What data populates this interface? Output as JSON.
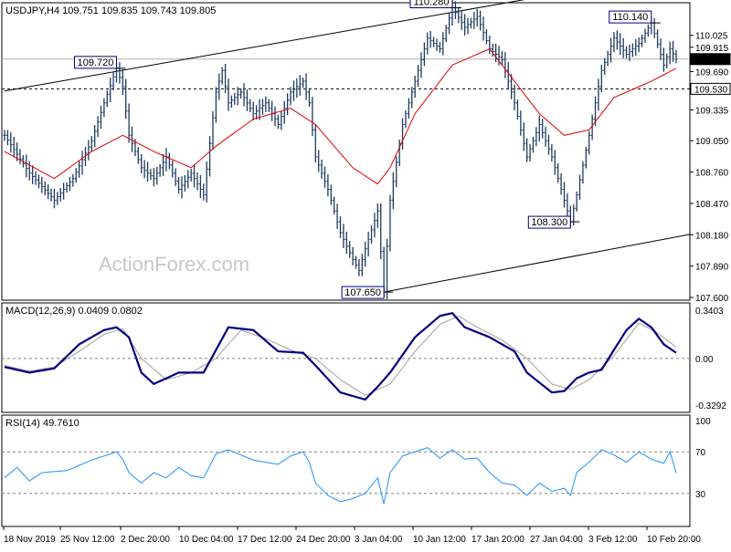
{
  "chart_data": [
    {
      "type": "candlestick",
      "header": "USDJPY,H4  109.751 109.835 109.743 109.805",
      "watermark": "ActionForex.com",
      "ylim": [
        107.6,
        110.2
      ],
      "y_ticks": [
        "110.025",
        "109.915",
        "109.805",
        "109.690",
        "109.530",
        "109.335",
        "109.050",
        "108.760",
        "108.470",
        "108.180",
        "107.890",
        "107.600"
      ],
      "price_line": 109.805,
      "dashed_level": 109.53,
      "moving_average_color": "#e00000",
      "bar_color": "#1f3a5f",
      "price_path": [
        [
          0,
          109.1
        ],
        [
          4,
          108.75
        ],
        [
          8,
          108.5
        ],
        [
          11,
          108.7
        ],
        [
          14,
          109.05
        ],
        [
          16,
          109.4
        ],
        [
          18,
          109.72
        ],
        [
          19,
          109.55
        ],
        [
          20,
          109.1
        ],
        [
          22,
          108.8
        ],
        [
          24,
          108.7
        ],
        [
          26,
          108.9
        ],
        [
          28,
          108.6
        ],
        [
          30,
          108.75
        ],
        [
          32,
          108.55
        ],
        [
          34,
          109.5
        ],
        [
          35,
          109.7
        ],
        [
          36,
          109.4
        ],
        [
          38,
          109.5
        ],
        [
          40,
          109.3
        ],
        [
          42,
          109.4
        ],
        [
          44,
          109.2
        ],
        [
          46,
          109.5
        ],
        [
          48,
          109.6
        ],
        [
          49,
          109.4
        ],
        [
          50,
          108.9
        ],
        [
          52,
          108.6
        ],
        [
          54,
          108.2
        ],
        [
          56,
          107.95
        ],
        [
          57,
          107.85
        ],
        [
          58,
          108.05
        ],
        [
          60,
          108.4
        ],
        [
          61,
          107.65
        ],
        [
          62,
          108.5
        ],
        [
          64,
          109.2
        ],
        [
          66,
          109.6
        ],
        [
          68,
          110.0
        ],
        [
          70,
          109.9
        ],
        [
          72,
          110.28
        ],
        [
          74,
          110.1
        ],
        [
          76,
          110.2
        ],
        [
          78,
          109.9
        ],
        [
          80,
          109.8
        ],
        [
          82,
          109.4
        ],
        [
          84,
          108.9
        ],
        [
          86,
          109.2
        ],
        [
          88,
          108.9
        ],
        [
          90,
          108.5
        ],
        [
          91,
          108.3
        ],
        [
          92,
          108.55
        ],
        [
          94,
          109.1
        ],
        [
          96,
          109.7
        ],
        [
          98,
          110.0
        ],
        [
          100,
          109.85
        ],
        [
          102,
          109.95
        ],
        [
          104,
          110.14
        ],
        [
          106,
          109.75
        ],
        [
          107,
          109.9
        ],
        [
          108,
          109.805
        ]
      ],
      "ma_path": [
        [
          0,
          108.95
        ],
        [
          8,
          108.7
        ],
        [
          14,
          108.95
        ],
        [
          19,
          109.1
        ],
        [
          24,
          108.95
        ],
        [
          30,
          108.8
        ],
        [
          34,
          109.0
        ],
        [
          40,
          109.25
        ],
        [
          46,
          109.35
        ],
        [
          50,
          109.2
        ],
        [
          56,
          108.8
        ],
        [
          60,
          108.65
        ],
        [
          62,
          108.8
        ],
        [
          66,
          109.3
        ],
        [
          72,
          109.75
        ],
        [
          78,
          109.9
        ],
        [
          82,
          109.6
        ],
        [
          86,
          109.3
        ],
        [
          90,
          109.1
        ],
        [
          94,
          109.15
        ],
        [
          98,
          109.45
        ],
        [
          104,
          109.6
        ],
        [
          108,
          109.72
        ]
      ],
      "annotations": [
        {
          "label": "109.720",
          "i": 18,
          "price": 109.72
        },
        {
          "label": "110.280",
          "i": 72,
          "price": 110.28
        },
        {
          "label": "110.140",
          "i": 104,
          "price": 110.14
        },
        {
          "label": "108.300",
          "i": 91,
          "price": 108.3
        },
        {
          "label": "107.650",
          "i": 61,
          "price": 107.65
        }
      ],
      "channel_upper": [
        [
          0,
          109.51
        ],
        [
          88,
          110.4
        ]
      ],
      "channel_lower": [
        [
          61,
          107.65
        ],
        [
          108,
          108.15
        ]
      ]
    },
    {
      "type": "line",
      "header": "MACD(12,26,9) 0.0409 0.0802",
      "ylim": [
        -0.3292,
        0.3403
      ],
      "y_ticks": [
        "0.3403",
        "0.00",
        "-0.3292"
      ],
      "colors": {
        "macd": "#000080",
        "signal": "#a0a0a0"
      },
      "macd": [
        [
          0,
          -0.06
        ],
        [
          4,
          -0.1
        ],
        [
          8,
          -0.07
        ],
        [
          12,
          0.1
        ],
        [
          16,
          0.2
        ],
        [
          18,
          0.22
        ],
        [
          20,
          0.15
        ],
        [
          22,
          -0.1
        ],
        [
          24,
          -0.18
        ],
        [
          28,
          -0.1
        ],
        [
          32,
          -0.1
        ],
        [
          34,
          0.06
        ],
        [
          36,
          0.22
        ],
        [
          40,
          0.2
        ],
        [
          44,
          0.05
        ],
        [
          48,
          0.04
        ],
        [
          50,
          -0.05
        ],
        [
          54,
          -0.24
        ],
        [
          58,
          -0.29
        ],
        [
          60,
          -0.2
        ],
        [
          62,
          -0.1
        ],
        [
          66,
          0.15
        ],
        [
          70,
          0.3
        ],
        [
          72,
          0.32
        ],
        [
          74,
          0.22
        ],
        [
          78,
          0.15
        ],
        [
          82,
          0.05
        ],
        [
          84,
          -0.1
        ],
        [
          88,
          -0.24
        ],
        [
          90,
          -0.23
        ],
        [
          92,
          -0.14
        ],
        [
          94,
          -0.1
        ],
        [
          96,
          -0.08
        ],
        [
          100,
          0.2
        ],
        [
          102,
          0.28
        ],
        [
          104,
          0.22
        ],
        [
          106,
          0.1
        ],
        [
          108,
          0.04
        ]
      ],
      "signal": [
        [
          0,
          -0.05
        ],
        [
          4,
          -0.09
        ],
        [
          8,
          -0.06
        ],
        [
          12,
          0.05
        ],
        [
          16,
          0.17
        ],
        [
          19,
          0.21
        ],
        [
          22,
          0.0
        ],
        [
          26,
          -0.15
        ],
        [
          30,
          -0.1
        ],
        [
          34,
          0.0
        ],
        [
          38,
          0.2
        ],
        [
          42,
          0.14
        ],
        [
          46,
          0.06
        ],
        [
          50,
          0.0
        ],
        [
          54,
          -0.15
        ],
        [
          58,
          -0.26
        ],
        [
          62,
          -0.18
        ],
        [
          66,
          0.05
        ],
        [
          70,
          0.24
        ],
        [
          73,
          0.3
        ],
        [
          76,
          0.22
        ],
        [
          80,
          0.13
        ],
        [
          84,
          0.0
        ],
        [
          88,
          -0.18
        ],
        [
          91,
          -0.22
        ],
        [
          94,
          -0.15
        ],
        [
          98,
          0.02
        ],
        [
          102,
          0.25
        ],
        [
          105,
          0.18
        ],
        [
          108,
          0.08
        ]
      ]
    },
    {
      "type": "line",
      "header": "RSI(14) 49.7610",
      "ylim": [
        0,
        100
      ],
      "y_ticks": [
        "100",
        "70",
        "30",
        "0"
      ],
      "dashed_levels": [
        70,
        30
      ],
      "colors": {
        "rsi": "#1e90ff"
      },
      "rsi": [
        [
          0,
          45
        ],
        [
          2,
          55
        ],
        [
          4,
          42
        ],
        [
          6,
          50
        ],
        [
          10,
          52
        ],
        [
          14,
          62
        ],
        [
          18,
          70
        ],
        [
          19,
          63
        ],
        [
          20,
          50
        ],
        [
          22,
          40
        ],
        [
          24,
          50
        ],
        [
          26,
          45
        ],
        [
          28,
          55
        ],
        [
          30,
          47
        ],
        [
          32,
          45
        ],
        [
          34,
          68
        ],
        [
          36,
          72
        ],
        [
          40,
          62
        ],
        [
          44,
          58
        ],
        [
          46,
          66
        ],
        [
          48,
          70
        ],
        [
          49,
          60
        ],
        [
          50,
          40
        ],
        [
          52,
          28
        ],
        [
          54,
          22
        ],
        [
          56,
          25
        ],
        [
          58,
          30
        ],
        [
          60,
          45
        ],
        [
          61,
          20
        ],
        [
          62,
          50
        ],
        [
          64,
          66
        ],
        [
          66,
          70
        ],
        [
          68,
          74
        ],
        [
          70,
          64
        ],
        [
          72,
          72
        ],
        [
          74,
          63
        ],
        [
          76,
          64
        ],
        [
          78,
          50
        ],
        [
          80,
          40
        ],
        [
          82,
          38
        ],
        [
          84,
          28
        ],
        [
          86,
          40
        ],
        [
          88,
          32
        ],
        [
          90,
          35
        ],
        [
          91,
          28
        ],
        [
          92,
          50
        ],
        [
          94,
          60
        ],
        [
          96,
          72
        ],
        [
          98,
          67
        ],
        [
          100,
          60
        ],
        [
          102,
          70
        ],
        [
          104,
          63
        ],
        [
          106,
          59
        ],
        [
          107,
          70
        ],
        [
          108,
          49.761
        ]
      ]
    }
  ],
  "x_ticks": [
    "18 Nov 2019",
    "25 Nov 12:00",
    "2 Dec 20:00",
    "10 Dec 04:00",
    "17 Dec 12:00",
    "24 Dec 20:00",
    "3 Jan 04:00",
    "10 Jan 12:00",
    "17 Jan 20:00",
    "27 Jan 04:00",
    "3 Feb 12:00",
    "10 Feb 20:00"
  ]
}
